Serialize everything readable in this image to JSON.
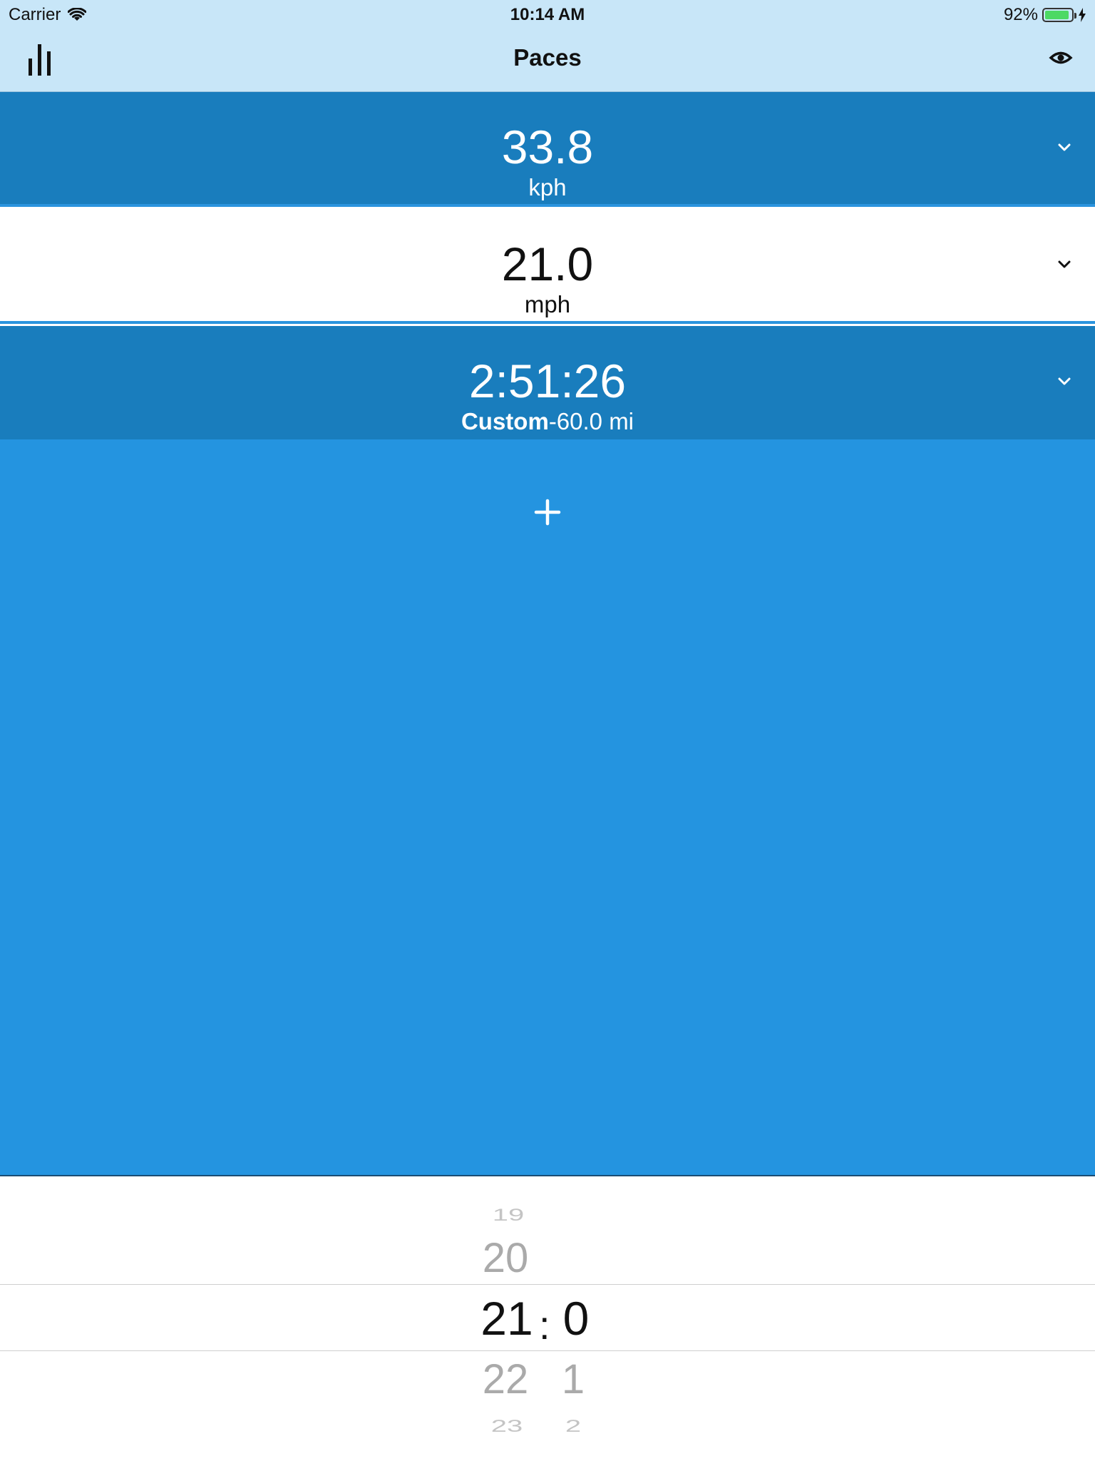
{
  "status_bar": {
    "carrier": "Carrier",
    "time": "10:14 AM",
    "battery_percent": "92%",
    "battery_level": 0.92,
    "battery_color": "#4cd964"
  },
  "nav": {
    "title": "Paces",
    "left_icon": "bar-chart-icon",
    "right_icon": "eye-icon"
  },
  "rows": [
    {
      "value": "33.8",
      "unit": "kph"
    },
    {
      "value": "21.0",
      "unit": "mph"
    },
    {
      "value": "2:51:26",
      "label": "Custom",
      "distance": "-60.0 mi"
    }
  ],
  "add_button": {
    "icon": "plus-icon",
    "label": "+"
  },
  "picker": {
    "separator": ":",
    "column_1": {
      "above_far": "19",
      "above": "20",
      "selected": "21",
      "below": "22",
      "below_far": "23"
    },
    "column_2": {
      "selected": "0",
      "below": "1",
      "below_far": "2"
    }
  },
  "colors": {
    "nav_background": "#c8e6f8",
    "row_dark": "#197dbd",
    "row_light": "#ffffff",
    "content_blue": "#2494e0"
  }
}
